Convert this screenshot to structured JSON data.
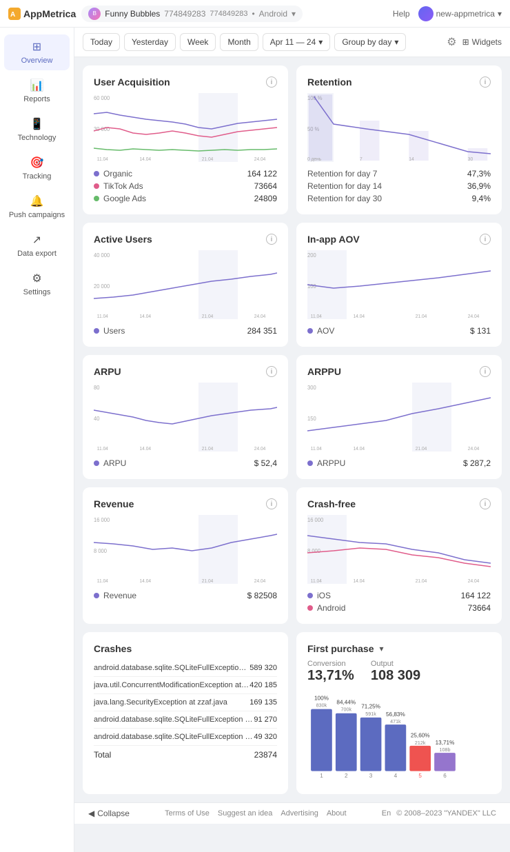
{
  "topbar": {
    "logo": "AppMetrica",
    "app_name": "Funny Bubbles",
    "app_id": "774849283",
    "platform": "Android",
    "help": "Help",
    "user": "new-appmetrica"
  },
  "filter_bar": {
    "today": "Today",
    "yesterday": "Yesterday",
    "week": "Week",
    "month": "Month",
    "date_range": "Apr 11 — 24",
    "group_by": "Group by day",
    "widgets": "Widgets"
  },
  "sidebar": {
    "overview": "Overview",
    "reports": "Reports",
    "technology": "Technology",
    "tracking": "Tracking",
    "push": "Push campaigns",
    "data_export": "Data export",
    "settings": "Settings"
  },
  "user_acquisition": {
    "title": "User Acquisition",
    "y_max": "60 000",
    "y_mid": "30 000",
    "legend": [
      {
        "color": "#7c6fcd",
        "label": "Organic",
        "value": "164 122"
      },
      {
        "color": "#e05c8a",
        "label": "TikTok Ads",
        "value": "73664"
      },
      {
        "color": "#66bb6a",
        "label": "Google Ads",
        "value": "24809"
      }
    ],
    "x_labels": [
      "11.04",
      "14.04",
      "21.04",
      "24.04"
    ]
  },
  "retention": {
    "title": "Retention",
    "y_max": "100%",
    "y_mid": "50%",
    "legend": [
      {
        "label": "Retention for day 7",
        "value": "47,3%"
      },
      {
        "label": "Retention for day 14",
        "value": "36,9%"
      },
      {
        "label": "Retention for day 30",
        "value": "9,4%"
      }
    ],
    "x_labels": [
      "0 день",
      "7",
      "14",
      "30"
    ]
  },
  "active_users": {
    "title": "Active Users",
    "y_max": "40 000",
    "y_mid": "20 000",
    "legend": [
      {
        "color": "#7c6fcd",
        "label": "Users",
        "value": "284 351"
      }
    ],
    "x_labels": [
      "11.04",
      "14.04",
      "21.04",
      "24.04"
    ]
  },
  "inapp_aov": {
    "title": "In-app AOV",
    "y_max": "200",
    "y_mid": "100",
    "legend": [
      {
        "color": "#7c6fcd",
        "label": "AOV",
        "value": "$ 131"
      }
    ],
    "x_labels": [
      "11.04",
      "14.04",
      "21.04",
      "24.04"
    ]
  },
  "arpu": {
    "title": "ARPU",
    "y_max": "80",
    "y_mid": "40",
    "legend": [
      {
        "color": "#7c6fcd",
        "label": "ARPU",
        "value": "$ 52,4"
      }
    ],
    "x_labels": [
      "11.04",
      "14.04",
      "21.04",
      "24.04"
    ]
  },
  "arppu": {
    "title": "ARPPU",
    "y_max": "300",
    "y_mid": "150",
    "legend": [
      {
        "color": "#7c6fcd",
        "label": "ARPPU",
        "value": "$ 287,2"
      }
    ],
    "x_labels": [
      "11.04",
      "14.04",
      "21.04",
      "24.04"
    ]
  },
  "revenue": {
    "title": "Revenue",
    "y_max": "16 000",
    "y_mid": "8 000",
    "legend": [
      {
        "color": "#7c6fcd",
        "label": "Revenue",
        "value": "$ 82508"
      }
    ],
    "x_labels": [
      "11.04",
      "14.04",
      "21.04",
      "24.04"
    ]
  },
  "crash_free": {
    "title": "Crash-free",
    "y_max": "16 000",
    "y_mid": "8 000",
    "legend": [
      {
        "color": "#7c6fcd",
        "label": "iOS",
        "value": "164 122"
      },
      {
        "color": "#e05c8a",
        "label": "Android",
        "value": "73664"
      }
    ],
    "x_labels": [
      "11.04",
      "14.04",
      "21.04",
      "24.04"
    ]
  },
  "crashes": {
    "title": "Crashes",
    "rows": [
      {
        "name": "android.database.sqlite.SQLiteFullException at Dashboard...",
        "value": "589 320"
      },
      {
        "name": "java.util.ConcurrentModificationException at HashMap.jso...",
        "value": "420 185"
      },
      {
        "name": "java.lang.SecurityException at zzaf.java",
        "value": "169 135"
      },
      {
        "name": "android.database.sqlite.SQLiteFullException at Dashboard...",
        "value": "91 270"
      },
      {
        "name": "android.database.sqlite.SQLiteFullException at Dashboard...",
        "value": "49 320"
      }
    ],
    "total_label": "Total",
    "total_value": "23874"
  },
  "first_purchase": {
    "title": "First purchase",
    "conversion_label": "Conversion",
    "conversion_value": "13,71%",
    "output_label": "Output",
    "output_value": "108 309",
    "bars": [
      {
        "pct": "100%",
        "count": "830k",
        "height": 100,
        "color": "#5c6bc0"
      },
      {
        "pct": "84,44%",
        "count": "700k",
        "height": 84,
        "color": "#5c6bc0"
      },
      {
        "pct": "71,25%",
        "count": "591k",
        "height": 71,
        "color": "#5c6bc0"
      },
      {
        "pct": "56,83%",
        "count": "471k",
        "height": 57,
        "color": "#5c6bc0"
      },
      {
        "pct": "25,60%",
        "count": "212k",
        "height": 26,
        "color": "#e57373"
      },
      {
        "pct": "13,71%",
        "count": "108b",
        "height": 14,
        "color": "#9575cd"
      }
    ],
    "x_labels": [
      "1",
      "2",
      "3",
      "4",
      "5",
      "6"
    ]
  },
  "footer": {
    "collapse": "Collapse",
    "terms": "Terms of Use",
    "suggest": "Suggest an idea",
    "advertising": "Advertising",
    "about": "About",
    "lang": "En",
    "copyright": "© 2008–2023 \"YANDEX\" LLC"
  }
}
